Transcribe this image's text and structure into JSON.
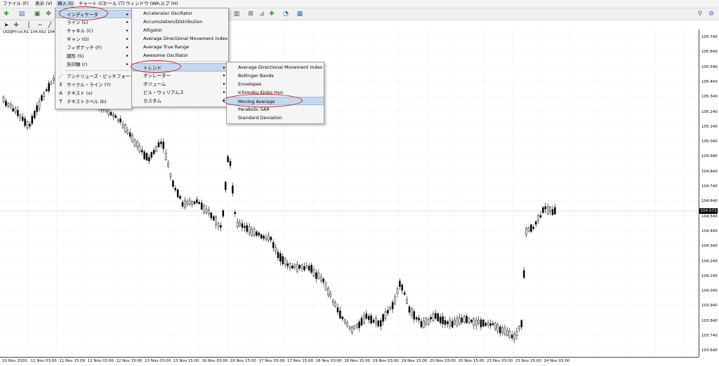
{
  "menubar": {
    "items": [
      "ファイル (F)",
      "表示 (V)",
      "挿入 (I)",
      "チャート (C)",
      "ツール (T)",
      "ウィンドウ (W)",
      "ヘルプ (H)"
    ]
  },
  "chart": {
    "symbol_label": "USDJPY-cd,H1  104.562 104",
    "current_price": "104.573",
    "price_labels": [
      "105.740",
      "105.640",
      "105.540",
      "105.440",
      "105.340",
      "105.240",
      "105.140",
      "105.040",
      "104.940",
      "104.840",
      "104.740",
      "104.640",
      "104.540",
      "104.440",
      "104.340",
      "104.240",
      "104.140",
      "104.040",
      "103.940",
      "103.840",
      "103.740",
      "103.640"
    ],
    "time_labels": [
      "10 Nov 2020",
      "11 Nov 03:00",
      "11 Nov 15:00",
      "12 Nov 03:00",
      "12 Nov 15:00",
      "13 Nov 03:00",
      "13 Nov 15:00",
      "16 Nov 03:00",
      "16 Nov 15:00",
      "17 Nov 03:00",
      "17 Nov 15:00",
      "18 Nov 03:00",
      "18 Nov 15:00",
      "19 Nov 03:00",
      "19 Nov 15:00",
      "20 Nov 03:00",
      "20 Nov 15:00",
      "23 Nov 03:00",
      "23 Nov 15:00",
      "24 Nov 03:00"
    ]
  },
  "menu_insert": {
    "items": [
      {
        "label": "インディケータ",
        "arrow": "▸",
        "icon": ""
      },
      {
        "label": "ライン (L)",
        "arrow": "▸",
        "icon": ""
      },
      {
        "label": "チャネル (C)",
        "arrow": "▸",
        "icon": ""
      },
      {
        "label": "ギャン (G)",
        "arrow": "▸",
        "icon": ""
      },
      {
        "label": "フィボナッチ (F)",
        "arrow": "▸",
        "icon": ""
      },
      {
        "label": "図形 (S)",
        "arrow": "▸",
        "icon": ""
      },
      {
        "label": "矢印類 (r)",
        "arrow": "▸",
        "icon": ""
      },
      {
        "label": "アンドリューズ・ピッチフォーク (A)",
        "arrow": "",
        "icon": "⋰"
      },
      {
        "label": "サイクル・ライン (Y)",
        "arrow": "",
        "icon": "⦀"
      },
      {
        "label": "テキスト (x)",
        "arrow": "",
        "icon": "A"
      },
      {
        "label": "テキストラベル (b)",
        "arrow": "",
        "icon": "T"
      }
    ]
  },
  "menu_indicators": {
    "items": [
      {
        "label": "Accelerator Oscillator",
        "arrow": ""
      },
      {
        "label": "Accumulation/Distribution",
        "arrow": ""
      },
      {
        "label": "Alligator",
        "arrow": ""
      },
      {
        "label": "Average Directional Movement Index",
        "arrow": ""
      },
      {
        "label": "Average True Range",
        "arrow": ""
      },
      {
        "label": "Awesome Oscillator",
        "arrow": ""
      },
      {
        "label": "トレンド",
        "arrow": "▸"
      },
      {
        "label": "オシレーター",
        "arrow": "▸"
      },
      {
        "label": "ボリューム",
        "arrow": "▸"
      },
      {
        "label": "ビル・ウィリアムス",
        "arrow": "▸"
      },
      {
        "label": "カスタム",
        "arrow": "▸"
      }
    ]
  },
  "menu_trend": {
    "items": [
      "Average Directional Movement Index",
      "Bollinger Bands",
      "Envelopes",
      "Ichimoku Kinko Hyo",
      "Moving Average",
      "Parabolic SAR",
      "Standard Deviation"
    ]
  },
  "colors": {
    "highlight": "#c4d9ef",
    "annotation": "#cc2222",
    "candle": "#000000"
  }
}
